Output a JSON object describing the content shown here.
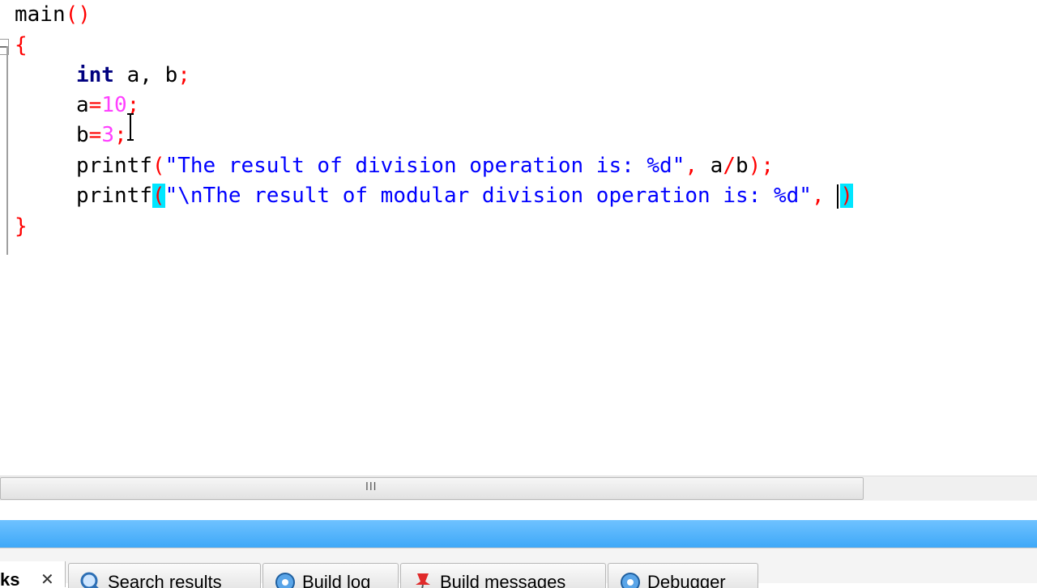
{
  "editor": {
    "line1": {
      "ident": "main",
      "paren": "()"
    },
    "line2": {
      "brace": "{"
    },
    "line3": {
      "kw": "int",
      "rest": " a, b",
      "semi": ";"
    },
    "line4": {
      "var": "a",
      "op": "=",
      "num": "10",
      "semi": ";"
    },
    "line5": {
      "var": "b",
      "op": "=",
      "num": "3",
      "semi": ";"
    },
    "line6": {
      "fn": "printf",
      "open": "(",
      "str": "\"The result of division operation is: %d\"",
      "comma": ",",
      "args": " a",
      "slash": "/",
      "arg2": "b",
      "close": ")",
      "semi": ";"
    },
    "line7": {
      "fn": "printf",
      "open": "(",
      "str": "\"\\nThe result of modular division operation is: %d\"",
      "comma": ",",
      "close": ")"
    },
    "line8": {
      "brace": "}"
    }
  },
  "scrollbar": {
    "grip": "III"
  },
  "tabs": {
    "active": {
      "label": "ks",
      "close": "✕"
    },
    "items": [
      {
        "label": "Search results",
        "icon": "search-icon"
      },
      {
        "label": "Build log",
        "icon": "gear-icon"
      },
      {
        "label": "Build messages",
        "icon": "pin-icon"
      },
      {
        "label": "Debugger",
        "icon": "debug-icon"
      }
    ]
  },
  "colors": {
    "keyword": "#00007f",
    "brace": "#ff0000",
    "number": "#ff40ff",
    "string": "#0000ff",
    "match_highlight": "#00e6ff",
    "splitter": "#3ea8f8"
  }
}
